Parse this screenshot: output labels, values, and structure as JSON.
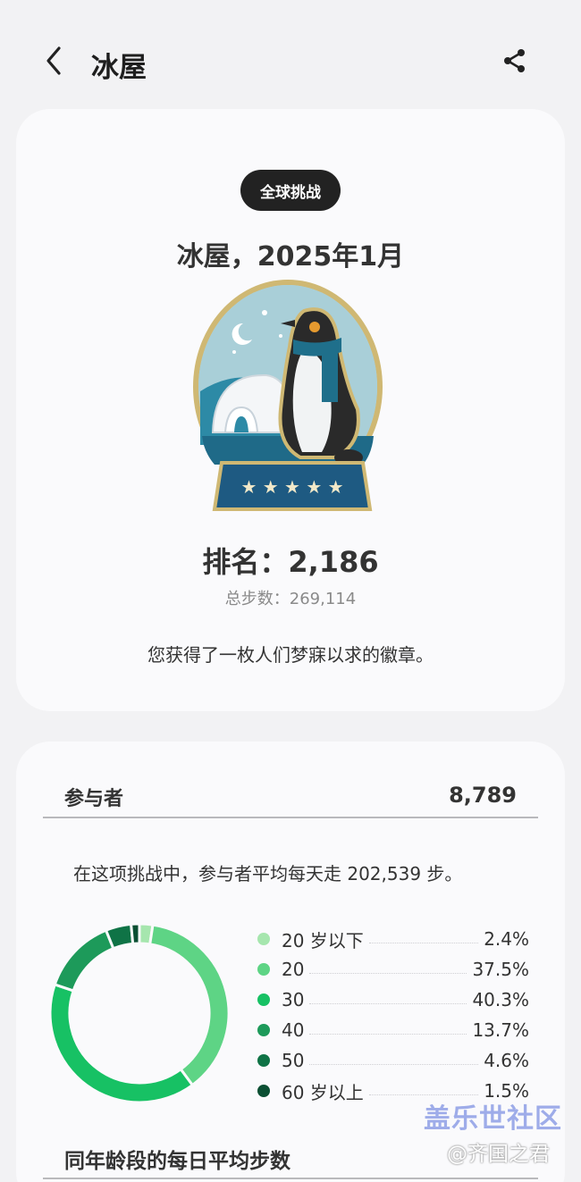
{
  "header": {
    "title": "冰屋",
    "back_icon": "chevron-left-icon",
    "share_icon": "share-icon"
  },
  "badge_card": {
    "chip_label": "全球挑战",
    "title": "冰屋，2025年1月",
    "medal_icon": "igloo-penguin-medal",
    "rank_text": "排名：2,186",
    "steps_text": "总步数：269,114",
    "description": "您获得了一枚人们梦寐以求的徽章。"
  },
  "participants_card": {
    "label": "参与者",
    "value": "8,789",
    "avg_text": "在这项挑战中，参与者平均每天走 202,539 步。",
    "section2_title": "同年龄段的每日平均步数"
  },
  "chart_data": {
    "type": "pie",
    "categories": [
      "20 岁以下",
      "20",
      "30",
      "40",
      "50",
      "60 岁以上"
    ],
    "values": [
      2.4,
      37.5,
      40.3,
      13.7,
      4.6,
      1.5
    ],
    "labels": [
      "2.4%",
      "37.5%",
      "40.3%",
      "13.7%",
      "4.6%",
      "1.5%"
    ],
    "colors": [
      "#a6e6ae",
      "#5ed485",
      "#17c164",
      "#1d9a5a",
      "#0f7346",
      "#0b4f33"
    ]
  },
  "watermark": {
    "line1": "盖乐世社区",
    "line2": "@齐国之君"
  }
}
